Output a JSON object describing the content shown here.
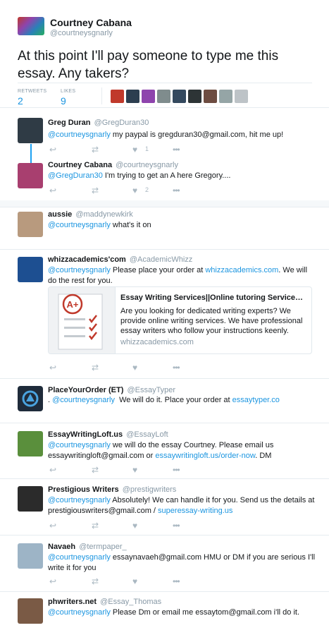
{
  "main_tweet": {
    "name": "Courtney Cabana",
    "handle": "@courtneysgnarly",
    "text": "At this point I'll pay someone to type me this essay. Any takers?",
    "retweets_label": "RETWEETS",
    "retweets_count": "2",
    "likes_label": "LIKES",
    "likes_count": "9",
    "liker_colors": [
      "#c0392b",
      "#2c3e50",
      "#8e44ad",
      "#7f8c8d",
      "#34495e",
      "#2d3436",
      "#6d4c41",
      "#95a5a6",
      "#bdc3c7"
    ]
  },
  "thread": [
    {
      "name": "Greg Duran",
      "handle": "@GregDuran30",
      "mention": "@courtneysgnarly",
      "text": " my paypal is gregduran30@gmail.com, hit me up!",
      "like_count": "1",
      "avatar_color": "#2f3b45"
    },
    {
      "name": "Courtney Cabana",
      "handle": "@courtneysgnarly",
      "mention": "@GregDuran30",
      "text": " I'm trying to get an A here Gregory....",
      "like_count": "2",
      "avatar_color": "#a83f6f"
    }
  ],
  "replies": [
    {
      "name": "aussie",
      "handle": "@maddynewkirk",
      "mention": "@courtneysgnarly",
      "text": " what's it on",
      "avatar_color": "#b89a7e"
    },
    {
      "name": "whizzacademics'com",
      "handle": "@AcademicWhizz",
      "mention": "@courtneysgnarly",
      "text": " Please place your order at ",
      "link": "whizzacademics.com",
      "text_after": ". We will do the rest for you.",
      "avatar_color": "#1d4f91"
    },
    {
      "name": "PlaceYourOrder (ET)",
      "handle": "@EssayTyper",
      "prefix": ". ",
      "mention": "@courtneysgnarly",
      "text": "  We will do it. Place your order at ",
      "link": "essaytyper.co",
      "avatar_color": "#1f2b3a"
    },
    {
      "name": "EssayWritingLoft.us",
      "handle": "@EssayLoft",
      "mention": "@courtneysgnarly",
      "text": " we will do the essay Courtney. Please email us essaywritingloft@gmail.com or ",
      "link": "essaywritingloft.us/order-now",
      "text_after": ". DM",
      "avatar_color": "#5a8f3c"
    },
    {
      "name": "Prestigious Writers",
      "handle": "@prestigwriters",
      "mention": "@courtneysgnarly",
      "text": " Absolutely! We can handle it for you. Send us the details at prestigiouswriters@gmail.com / ",
      "link": "superessay-writing.us",
      "avatar_color": "#2b2b2b"
    },
    {
      "name": "Navaeh",
      "handle": "@termpaper_",
      "mention": "@courtneysgnarly",
      "text": " essaynavaeh@gmail.com HMU or DM if you are serious I'll write it for you",
      "avatar_color": "#9db4c6"
    },
    {
      "name": "phwriters.net",
      "handle": "@Essay_Thomas",
      "mention": "@courtneysgnarly",
      "text": " Please Dm or email me essaytom@gmail.com i'll do it.",
      "avatar_color": "#7a5a45"
    }
  ],
  "card": {
    "title": "Essay Writing Services||Online tutoring Services||...",
    "description": "Are you looking for dedicated writing experts? We provide online writing services. We have professional essay writers who follow your instructions keenly.",
    "domain": "whizzacademics.com",
    "grade": "A+"
  },
  "icons": {
    "reply": "↩",
    "retweet": "⇄",
    "like": "♥",
    "more": "•••"
  }
}
